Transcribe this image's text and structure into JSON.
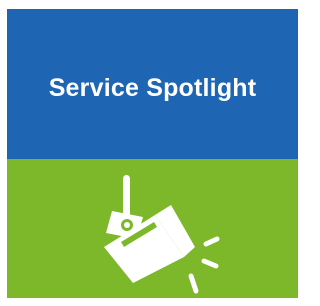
{
  "tile": {
    "title": "Service Spotlight",
    "icon": "spotlight-icon",
    "colors": {
      "header_background": "#1e65b4",
      "icon_background": "#7cb82a",
      "foreground": "#ffffff"
    }
  }
}
